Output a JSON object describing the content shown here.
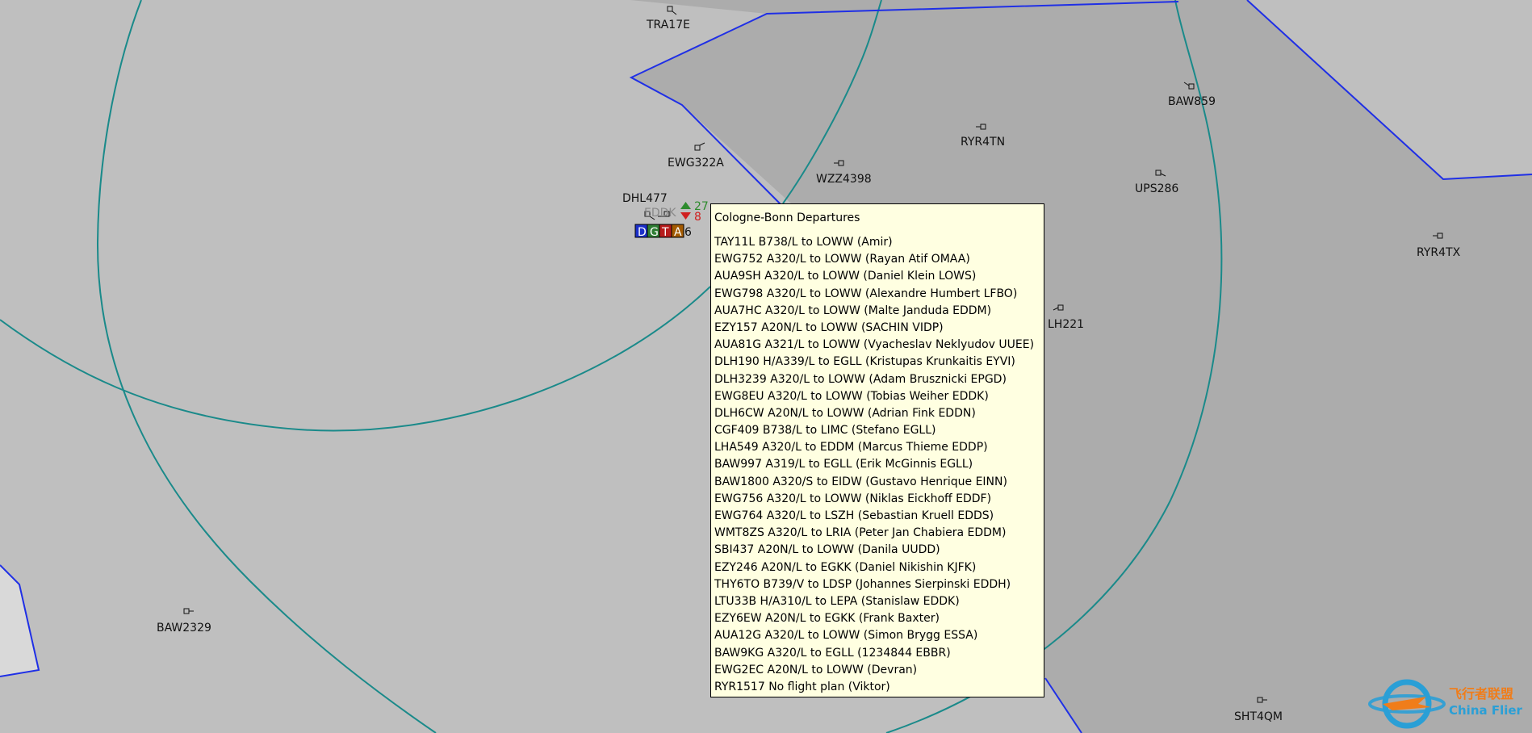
{
  "colors": {
    "background": "#bfbfbf",
    "sector_fill": "#acacac",
    "light_area": "#d9d9d9",
    "boundary_blue": "#1f2fe6",
    "range_ring_teal": "#1a8a8a",
    "popup_background": "#ffffe1"
  },
  "aircraft": [
    {
      "callsign": "TRA17E",
      "icon": "aircraft-target-icon"
    },
    {
      "callsign": "EWG322A",
      "icon": "aircraft-target-icon"
    },
    {
      "callsign": "WZZ4398",
      "icon": "aircraft-target-icon"
    },
    {
      "callsign": "RYR4TN",
      "icon": "aircraft-target-icon"
    },
    {
      "callsign": "BAW859",
      "icon": "aircraft-target-icon"
    },
    {
      "callsign": "UPS286",
      "icon": "aircraft-target-icon"
    },
    {
      "callsign": "RYR4TX",
      "icon": "aircraft-target-icon"
    },
    {
      "callsign": "LH221",
      "icon": "aircraft-target-icon"
    },
    {
      "callsign": "BAW2329",
      "icon": "aircraft-target-icon"
    },
    {
      "callsign": "SHT4QM",
      "icon": "aircraft-target-icon"
    },
    {
      "callsign": "DHL477",
      "icon": "aircraft-target-icon"
    }
  ],
  "airport": {
    "icao": "EDDK",
    "partial_label": "6",
    "arrivals_count": "27",
    "departures_count": "8",
    "controller_buttons": [
      {
        "label": "D",
        "color": "#1b2fc9"
      },
      {
        "label": "G",
        "color": "#2e7d32"
      },
      {
        "label": "T",
        "color": "#b71c1c"
      },
      {
        "label": "A",
        "color": "#a35a00"
      }
    ]
  },
  "departures_popup": {
    "title": "Cologne-Bonn Departures",
    "flights": [
      "TAY11L B738/L to LOWW (Amir)",
      "EWG752 A320/L to LOWW (Rayan Atif OMAA)",
      "AUA9SH A320/L to LOWW (Daniel Klein LOWS)",
      "EWG798 A320/L to LOWW (Alexandre Humbert LFBO)",
      "AUA7HC A320/L to LOWW (Malte Janduda EDDM)",
      "EZY157 A20N/L to LOWW (SACHIN VIDP)",
      "AUA81G A321/L to LOWW (Vyacheslav Neklyudov UUEE)",
      "DLH190 H/A339/L to EGLL (Kristupas Krunkaitis EYVI)",
      "DLH3239 A320/L to LOWW (Adam Brusznicki EPGD)",
      "EWG8EU A320/L to LOWW (Tobias Weiher EDDK)",
      "DLH6CW A20N/L to LOWW (Adrian Fink EDDN)",
      "CGF409 B738/L to LIMC (Stefano EGLL)",
      "LHA549 A320/L to EDDM (Marcus Thieme EDDP)",
      "BAW997 A319/L to EGLL (Erik McGinnis EGLL)",
      "BAW1800 A320/S to EIDW (Gustavo Henrique EINN)",
      "EWG756 A320/L to LOWW (Niklas Eickhoff EDDF)",
      "EWG764 A320/L to LSZH (Sebastian Kruell EDDS)",
      "WMT8ZS A320/L to LRIA (Peter Jan Chabiera EDDM)",
      "SBI437 A20N/L to LOWW (Danila UUDD)",
      "EZY246 A20N/L to EGKK (Daniel Nikishin KJFK)",
      "THY6TO B739/V to LDSP (Johannes Sierpinski EDDH)",
      "LTU33B H/A310/L to LEPA (Stanislaw EDDK)",
      "EZY6EW A20N/L to EGKK (Frank Baxter)",
      "AUA12G A320/L to LOWW (Simon Brygg ESSA)",
      "BAW9KG A320/L to EGLL (1234844 EBBR)",
      "EWG2EC A20N/L to LOWW (Devran)",
      "RYR1517 No flight plan (Viktor)"
    ]
  },
  "watermark": {
    "brand_cn": "飞行者联盟",
    "brand_en": "China Flier",
    "icon": "china-flier-logo-icon"
  }
}
